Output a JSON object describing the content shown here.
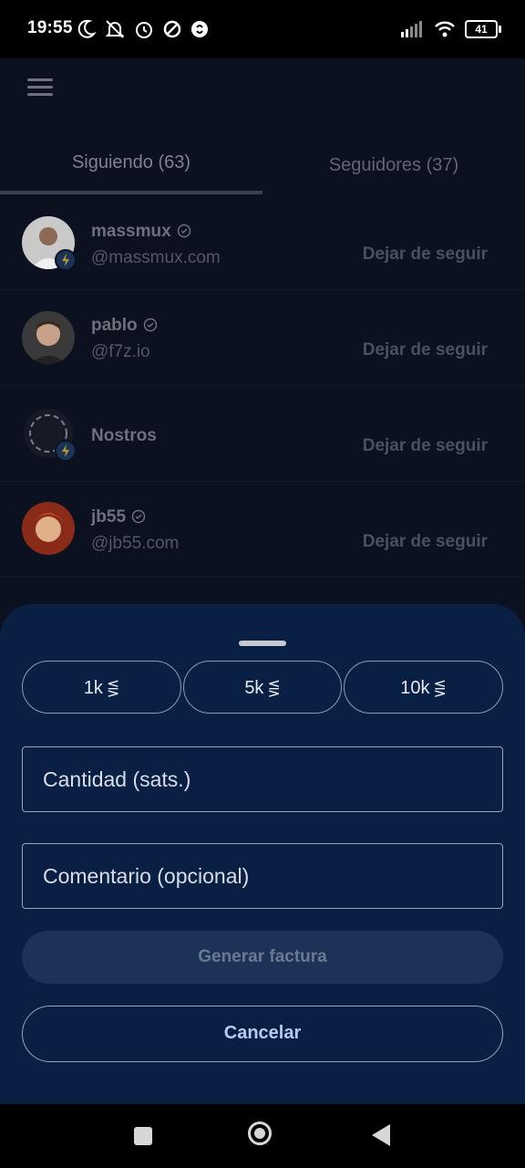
{
  "status_bar": {
    "time": "19:55",
    "battery": "41",
    "left_icons": [
      "moon-icon",
      "bell-off-icon",
      "alarm-icon",
      "shield-icon",
      "shazam-icon"
    ],
    "right_icons": [
      "signal-icon",
      "wifi-icon",
      "battery-icon"
    ]
  },
  "tabs": [
    {
      "label": "Siguiendo (63)",
      "selected": true
    },
    {
      "label": "Seguidores (37)",
      "selected": false
    }
  ],
  "following": [
    {
      "name": "massmux",
      "handle": "@massmux.com",
      "verified": true,
      "action": "Dejar de seguir",
      "badge": true
    },
    {
      "name": "pablo",
      "handle": "@f7z.io",
      "verified": true,
      "action": "Dejar de seguir",
      "badge": false
    },
    {
      "name": "Nostros",
      "handle": "",
      "verified": false,
      "action": "Dejar de seguir",
      "badge": true
    },
    {
      "name": "jb55",
      "handle": "@jb55.com",
      "verified": true,
      "action": "Dejar de seguir",
      "badge": false
    }
  ],
  "zap_sheet": {
    "amounts": [
      {
        "label": "1k",
        "symbol": "⋚"
      },
      {
        "label": "5k",
        "symbol": "⋚"
      },
      {
        "label": "10k",
        "symbol": "⋚"
      }
    ],
    "amount_placeholder": "Cantidad (sats.)",
    "comment_placeholder": "Comentario (opcional)",
    "generate_label": "Generar factura",
    "cancel_label": "Cancelar"
  },
  "colors": {
    "sheet_bg": "#0a1f44",
    "accent_text": "#b9c8f5",
    "app_bg": "#0c111f"
  }
}
